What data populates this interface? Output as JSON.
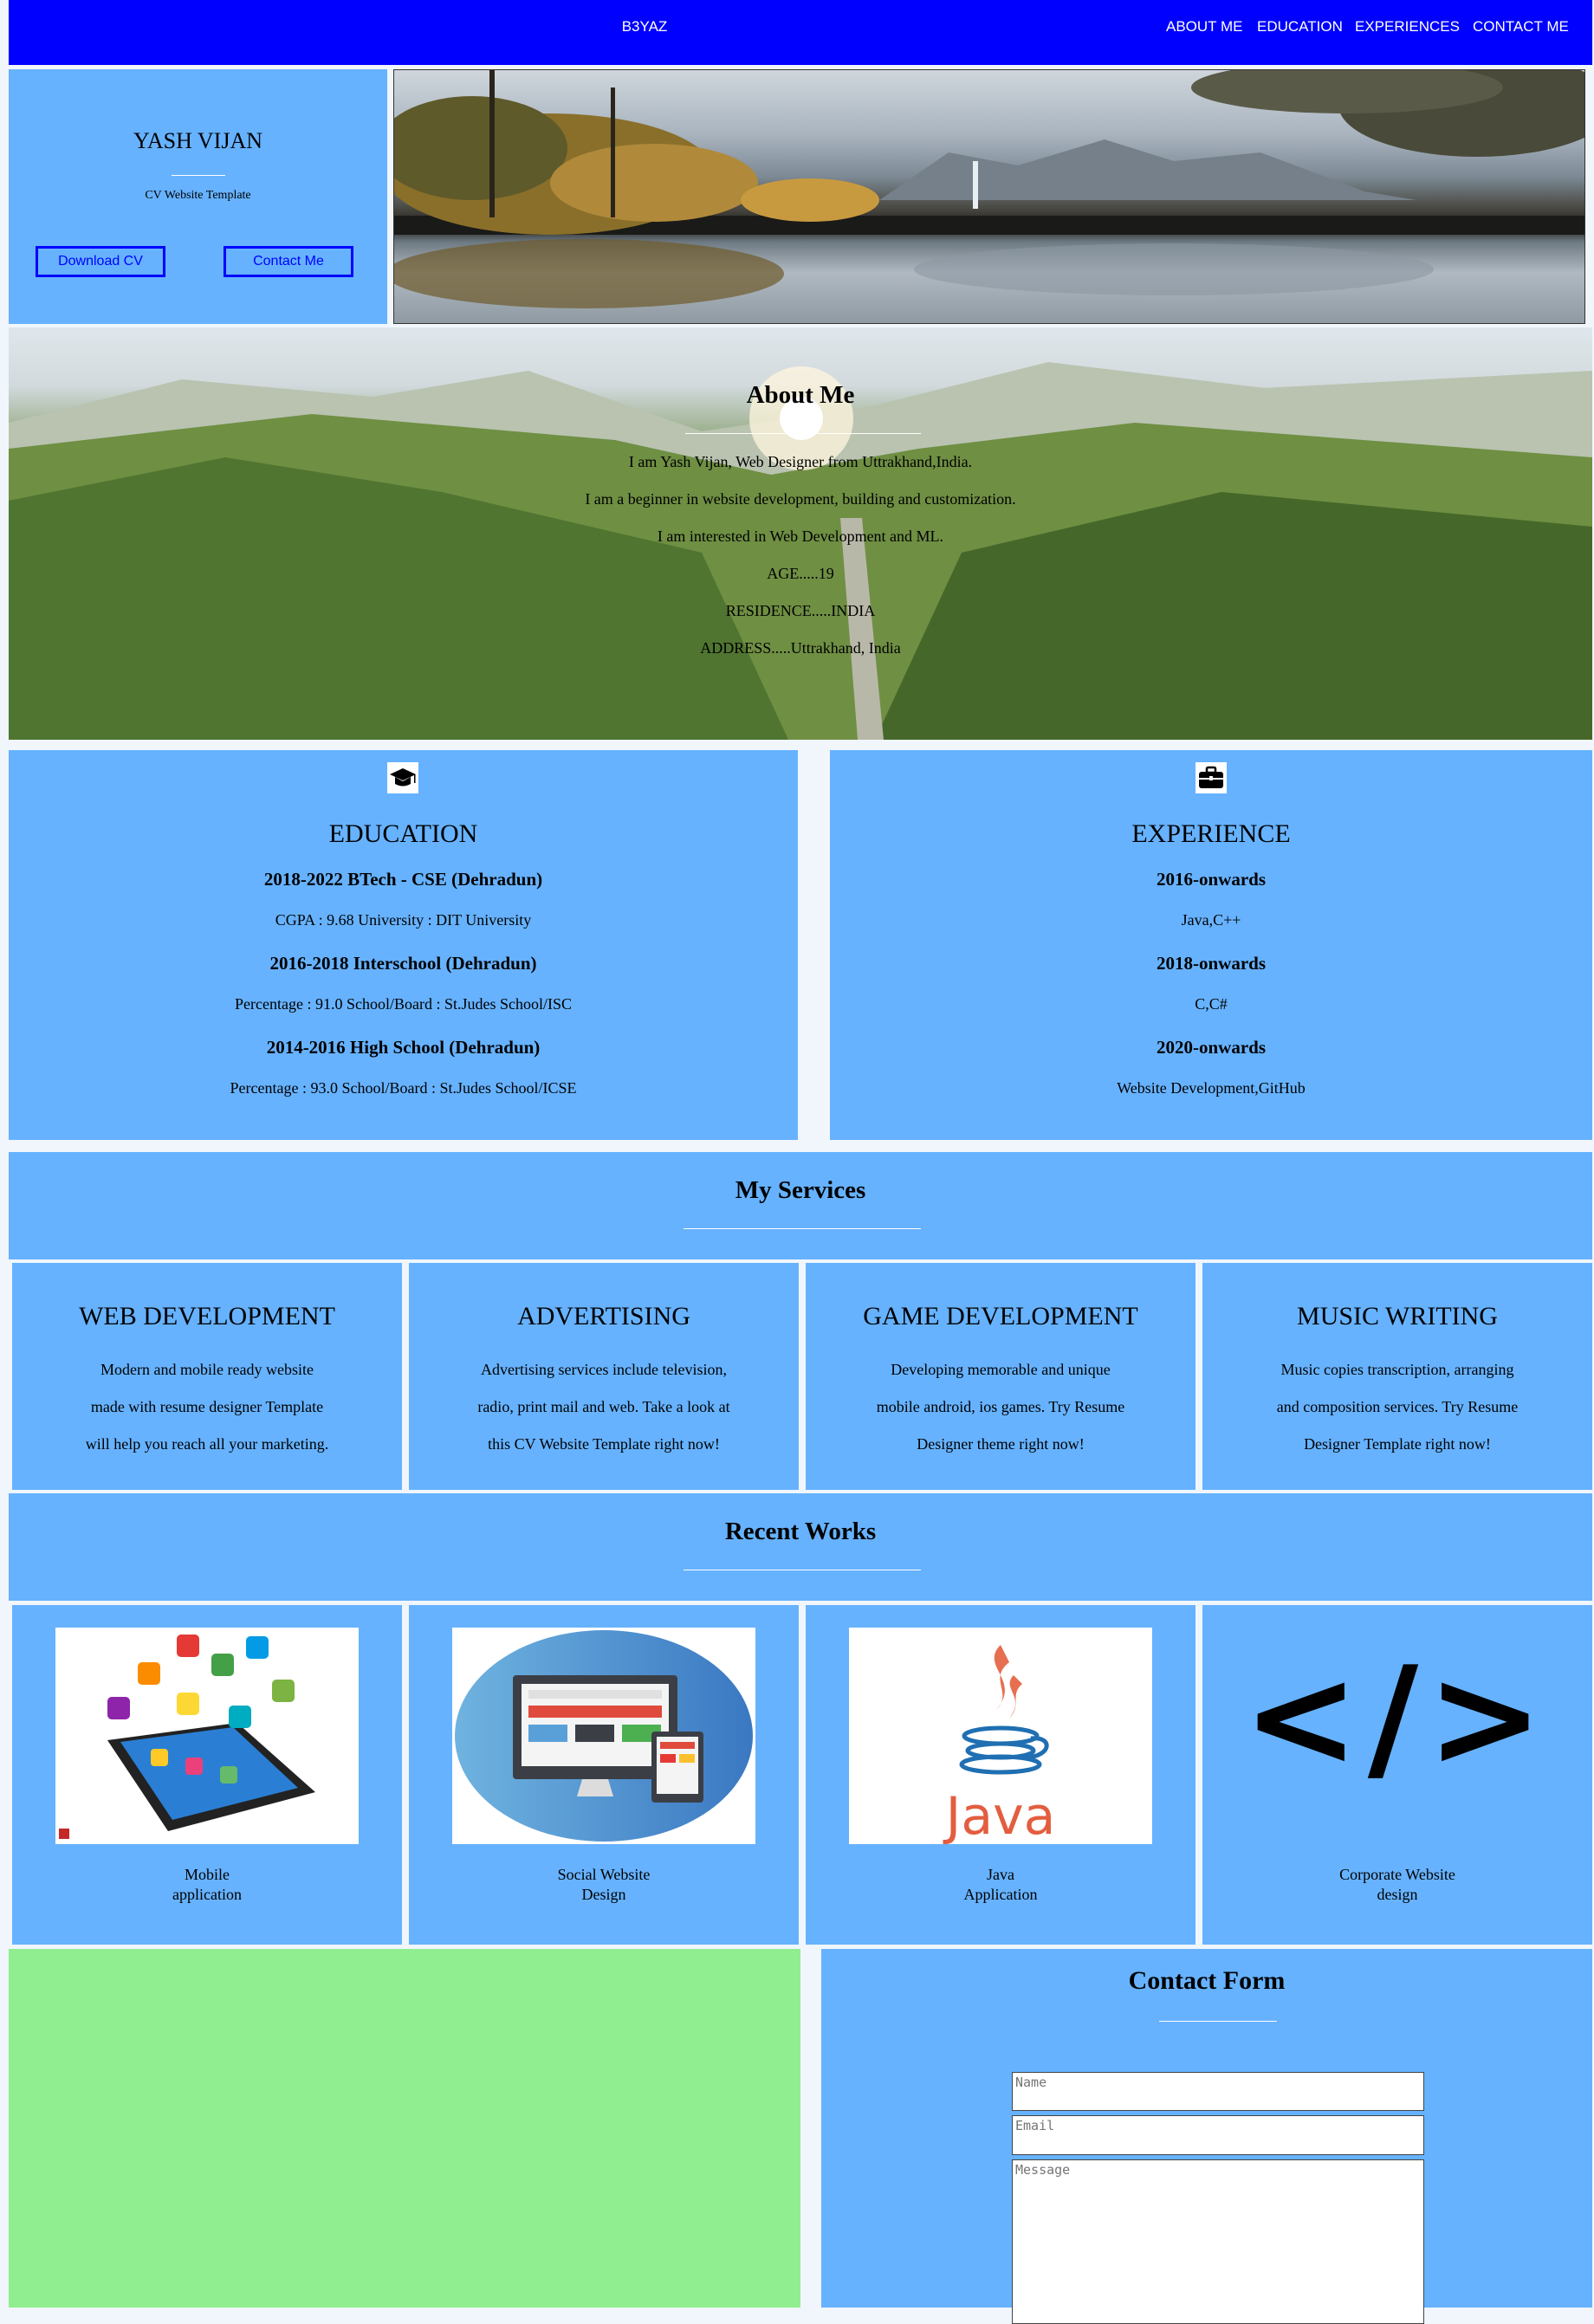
{
  "nav": {
    "brand": "B3YAZ",
    "links": [
      "ABOUT ME",
      "EDUCATION",
      "EXPERIENCES",
      "CONTACT ME"
    ]
  },
  "profile": {
    "name": "YASH VIJAN",
    "subtitle": "CV Website Template",
    "download_label": "Download CV",
    "contact_label": "Contact Me"
  },
  "about": {
    "title": "About Me",
    "lines": [
      "I am Yash Vijan, Web Designer from Uttrakhand,India.",
      "I am a beginner in website development, building and customization.",
      "I am interested in Web Development and ML.",
      "AGE.....19",
      "RESIDENCE.....INDIA",
      "ADDRESS.....Uttrakhand, India"
    ]
  },
  "education": {
    "icon": "graduation-cap-icon",
    "title": "EDUCATION",
    "items": [
      {
        "title": "2018-2022 BTech - CSE (Dehradun)",
        "sub": "CGPA : 9.68 University : DIT University"
      },
      {
        "title": "2016-2018 Interschool (Dehradun)",
        "sub": "Percentage : 91.0 School/Board : St.Judes School/ISC"
      },
      {
        "title": "2014-2016 High School (Dehradun)",
        "sub": "Percentage : 93.0 School/Board : St.Judes School/ICSE"
      }
    ]
  },
  "experience": {
    "icon": "briefcase-icon",
    "title": "EXPERIENCE",
    "items": [
      {
        "title": "2016-onwards",
        "sub": "Java,C++"
      },
      {
        "title": "2018-onwards",
        "sub": "C,C#"
      },
      {
        "title": "2020-onwards",
        "sub": "Website Development,GitHub"
      }
    ]
  },
  "services": {
    "title": "My Services",
    "items": [
      {
        "title": "WEB DEVELOPMENT",
        "lines": [
          "Modern and mobile ready website",
          "made with resume designer Template",
          "will help you reach all your marketing."
        ]
      },
      {
        "title": "ADVERTISING",
        "lines": [
          "Advertising services include television,",
          "radio, print mail and web. Take a look at",
          "this CV Website Template right now!"
        ]
      },
      {
        "title": "GAME DEVELOPMENT",
        "lines": [
          "Developing memorable and unique",
          "mobile android, ios games. Try Resume",
          "Designer theme right now!"
        ]
      },
      {
        "title": "MUSIC WRITING",
        "lines": [
          "Music copies transcription, arranging",
          "and composition services. Try Resume",
          "Designer Template right now!"
        ]
      }
    ]
  },
  "works": {
    "title": "Recent Works",
    "items": [
      {
        "line1": "Mobile",
        "line2": "application",
        "icon": "mobile-apps-icon"
      },
      {
        "line1": "Social Website",
        "line2": "Design",
        "icon": "monitor-devices-icon"
      },
      {
        "line1": "Java",
        "line2": "Application",
        "icon": "java-logo-icon",
        "logo_text": "Java"
      },
      {
        "line1": "Corporate Website",
        "line2": "design",
        "icon": "code-tag-icon",
        "logo_text": "</>"
      }
    ]
  },
  "contact": {
    "title": "Contact Form",
    "name_placeholder": "Name",
    "email_placeholder": "Email",
    "message_placeholder": "Message"
  },
  "colors": {
    "nav": "#0000ff",
    "panel": "#66b2ff",
    "map": "#90ee90",
    "button_border": "#0000ff"
  }
}
